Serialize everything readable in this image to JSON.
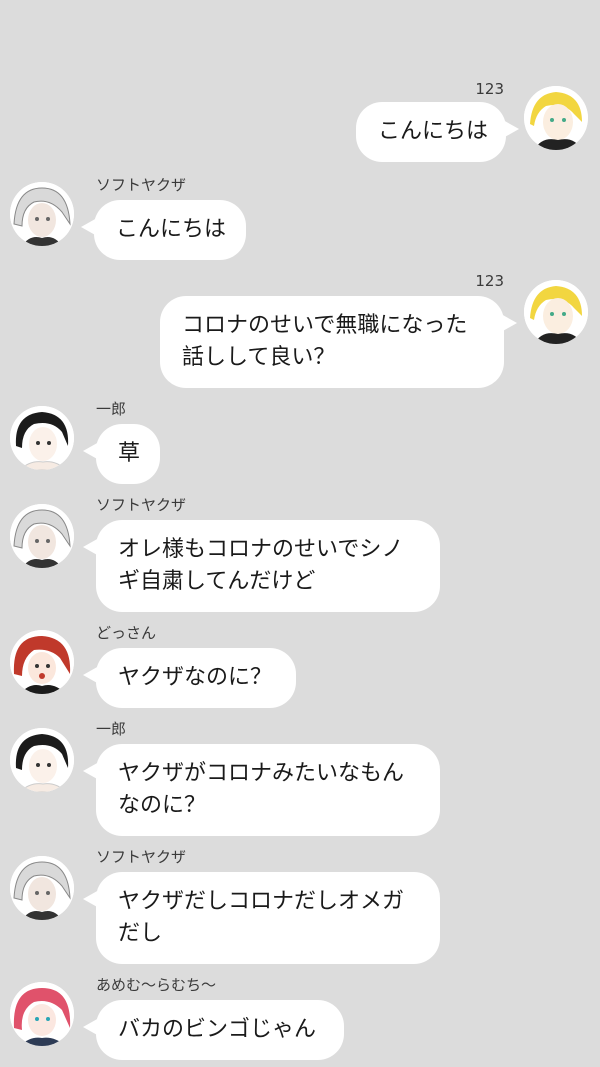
{
  "colors": {
    "background": "#dcdcdc",
    "bubble": "#ffffff",
    "text": "#1a1a1a",
    "name": "#3a3a3a"
  },
  "messages": [
    {
      "side": "right",
      "name": "123",
      "avatar": "blonde-character-avatar-icon",
      "lines": [
        "こんにちは"
      ]
    },
    {
      "side": "left",
      "name": "ソフトヤクザ",
      "avatar": "white-hair-character-avatar-icon",
      "lines": [
        "こんにちは"
      ]
    },
    {
      "side": "right",
      "name": "123",
      "avatar": "blonde-character-avatar-icon",
      "lines": [
        "コロナのせいで無職になった",
        "話しして良い？"
      ]
    },
    {
      "side": "left",
      "name": "一郎",
      "avatar": "black-hair-character-avatar-icon",
      "lines": [
        "草"
      ]
    },
    {
      "side": "left",
      "name": "ソフトヤクザ",
      "avatar": "white-hair-character-avatar-icon",
      "lines": [
        "オレ様もコロナのせいでシノ",
        "ギ自粛してんだけど"
      ]
    },
    {
      "side": "left",
      "name": "どっさん",
      "avatar": "red-hair-character-avatar-icon",
      "lines": [
        "ヤクザなのに？"
      ]
    },
    {
      "side": "left",
      "name": "一郎",
      "avatar": "black-hair-character-avatar-icon",
      "lines": [
        "ヤクザがコロナみたいなもん",
        "なのに？"
      ]
    },
    {
      "side": "left",
      "name": "ソフトヤクザ",
      "avatar": "white-hair-character-avatar-icon",
      "lines": [
        "ヤクザだしコロナだしオメガ",
        "だし"
      ]
    },
    {
      "side": "left",
      "name": "あめむ〜らむち〜",
      "avatar": "pink-hair-character-avatar-icon",
      "lines": [
        "バカのビンゴじゃん"
      ]
    }
  ]
}
